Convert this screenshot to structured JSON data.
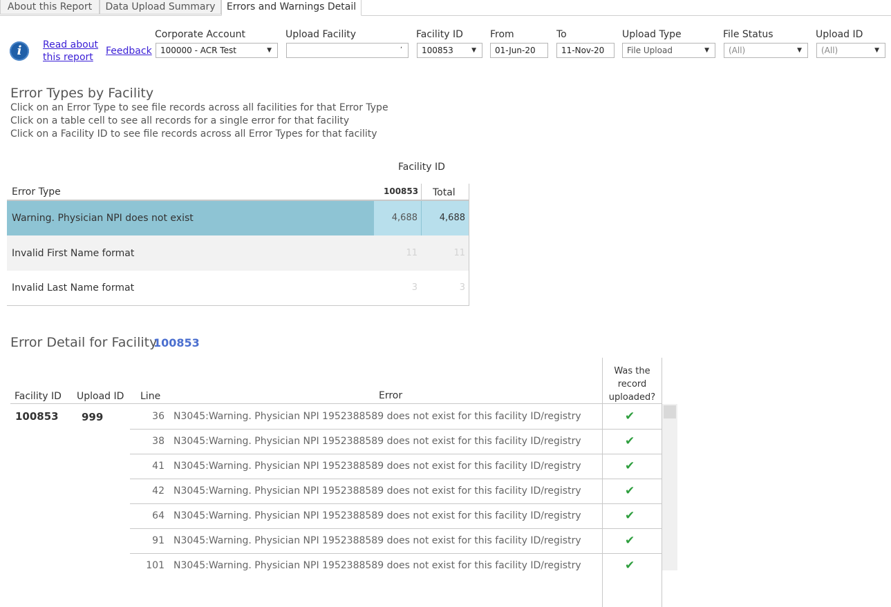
{
  "tabs": [
    {
      "label": "About this Report"
    },
    {
      "label": "Data Upload Summary"
    },
    {
      "label": "Errors and Warnings Detail"
    }
  ],
  "header": {
    "info_icon_glyph": "i",
    "read_about_line1": "Read about",
    "read_about_line2": "this report",
    "feedback": "Feedback"
  },
  "filters": {
    "corporate_account": {
      "label": "Corporate Account",
      "value": "100000 - ACR Test"
    },
    "upload_facility": {
      "label": "Upload Facility",
      "value": ""
    },
    "facility_id": {
      "label": "Facility ID",
      "value": "100853"
    },
    "from": {
      "label": "From",
      "value": "01-Jun-20"
    },
    "to": {
      "label": "To",
      "value": "11-Nov-20"
    },
    "upload_type": {
      "label": "Upload Type",
      "value": "File Upload"
    },
    "file_status": {
      "label": "File Status",
      "value": "(All)"
    },
    "upload_id": {
      "label": "Upload ID",
      "value": "(All)"
    }
  },
  "error_types": {
    "title": "Error Types by Facility",
    "instructions": [
      "Click on an Error Type to see file records across all facilities for that Error Type",
      "Click on a table cell to see all records for a single error for that facility",
      "Click on a Facility ID to see file records across all Error Types for that facility"
    ],
    "column_group": "Facility ID",
    "row_header": "Error Type",
    "col_facility": "100853",
    "col_total": "Total",
    "rows": [
      {
        "type": "Warning. Physician NPI  does not exist",
        "facility": "4,688",
        "total": "4,688"
      },
      {
        "type": "Invalid First Name format",
        "facility": "11",
        "total": "11"
      },
      {
        "type": "Invalid Last Name format",
        "facility": "3",
        "total": "3"
      }
    ]
  },
  "error_detail": {
    "title": "Error Detail for Facility",
    "facility": "100853",
    "headers": {
      "facility_id": "Facility ID",
      "upload_id": "Upload ID",
      "line": "Line",
      "error": "Error",
      "uploaded_line1": "Was the",
      "uploaded_line2": "record",
      "uploaded_line3": "uploaded?"
    },
    "facility_value": "100853",
    "upload_value": "999",
    "rows": [
      {
        "line": "36",
        "error": "N3045:Warning. Physician NPI 1952388589 does not exist for this facility ID/registry",
        "uploaded": "✔"
      },
      {
        "line": "38",
        "error": "N3045:Warning. Physician NPI 1952388589 does not exist for this facility ID/registry",
        "uploaded": "✔"
      },
      {
        "line": "41",
        "error": "N3045:Warning. Physician NPI 1952388589 does not exist for this facility ID/registry",
        "uploaded": "✔"
      },
      {
        "line": "42",
        "error": "N3045:Warning. Physician NPI 1952388589 does not exist for this facility ID/registry",
        "uploaded": "✔"
      },
      {
        "line": "64",
        "error": "N3045:Warning. Physician NPI 1952388589 does not exist for this facility ID/registry",
        "uploaded": "✔"
      },
      {
        "line": "91",
        "error": "N3045:Warning. Physician NPI 1952388589 does not exist for this facility ID/registry",
        "uploaded": "✔"
      },
      {
        "line": "101",
        "error": "N3045:Warning. Physician NPI 1952388589 does not exist for this facility ID/registry",
        "uploaded": "✔"
      }
    ]
  },
  "colors": {
    "highlight_row": "#8ec4d4",
    "highlight_cell": "#b8dfec",
    "alt_row": "#f2f2f2",
    "facility_link": "#4b6fcf",
    "check": "#2e9e3e"
  }
}
